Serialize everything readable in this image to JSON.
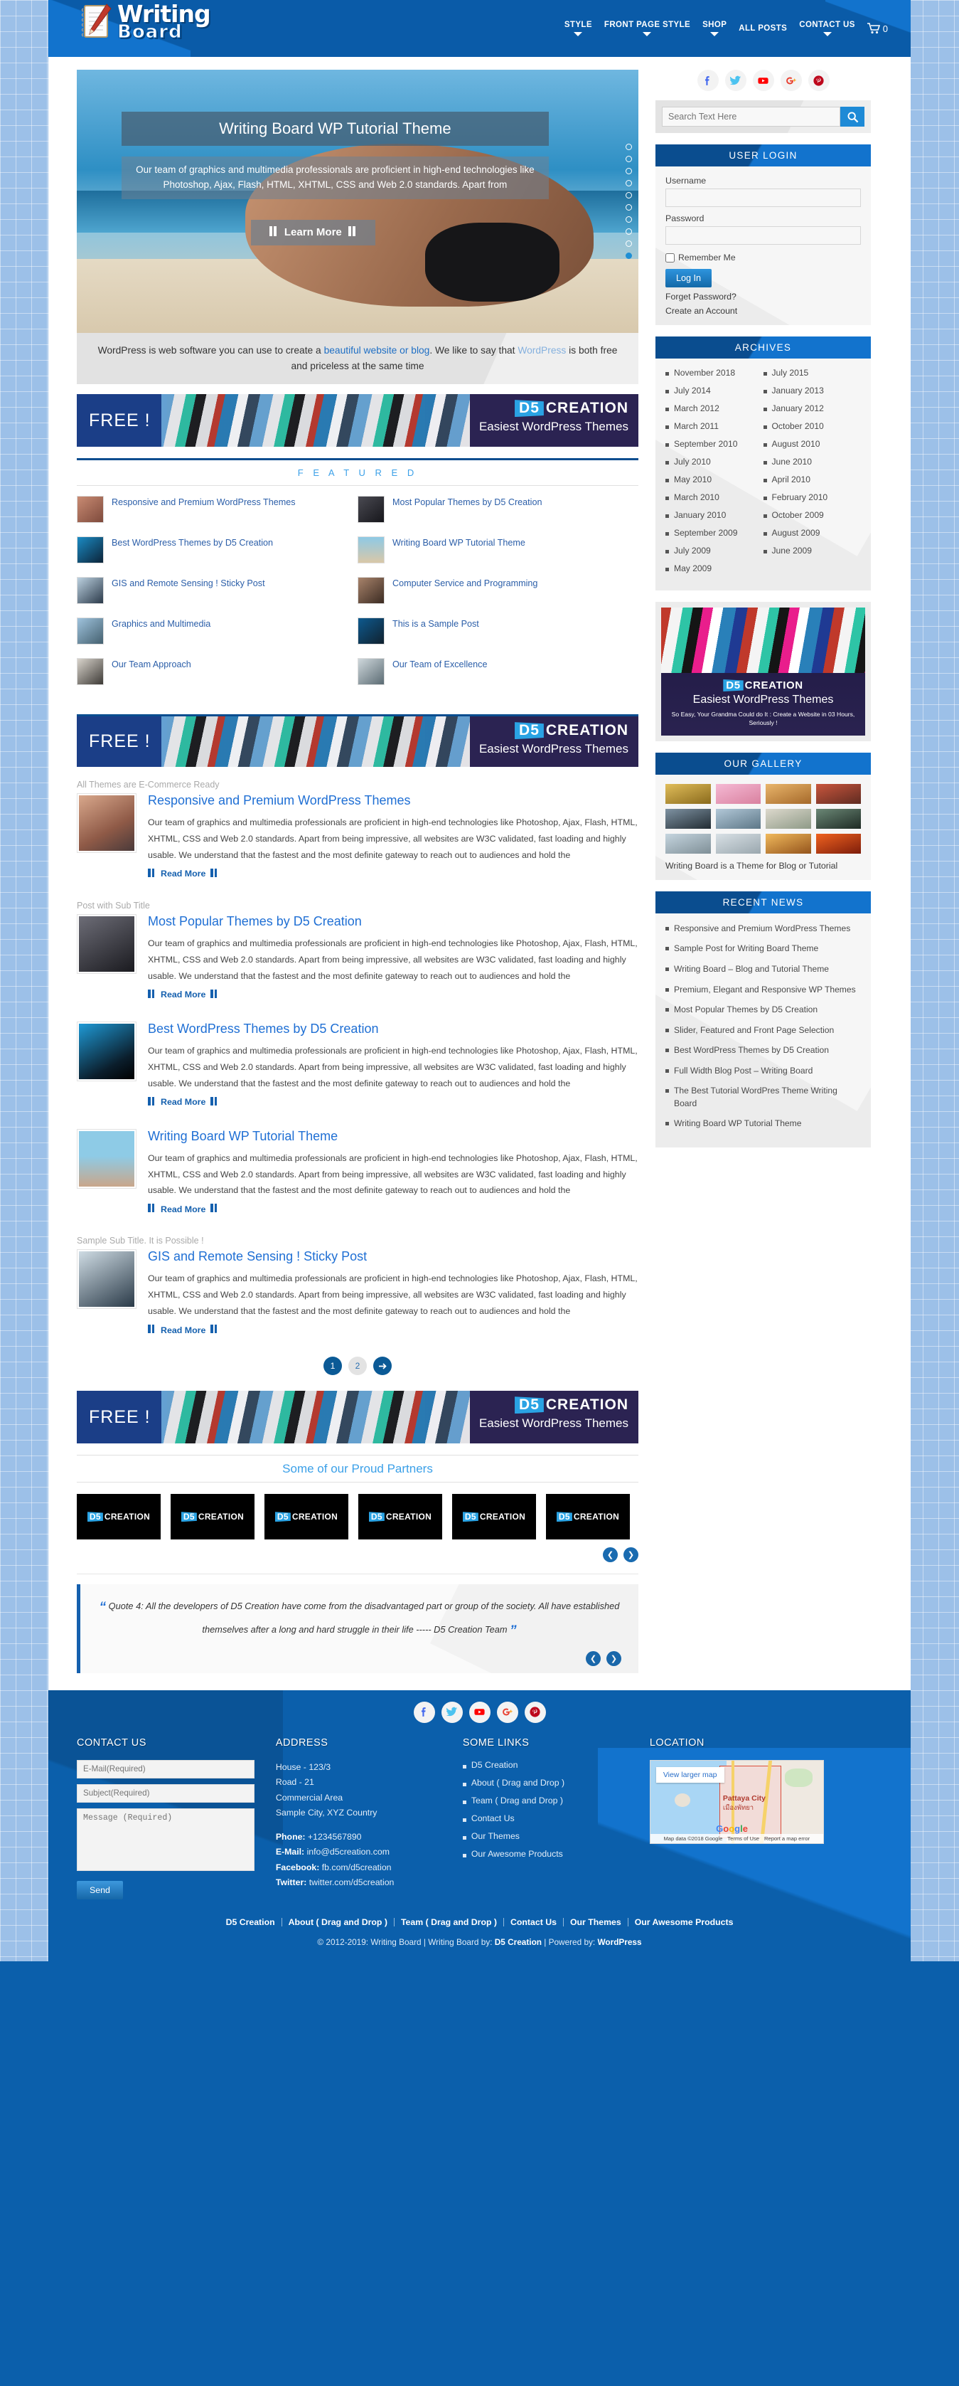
{
  "header": {
    "logo_line1": "Writing",
    "logo_line2": "Board",
    "nav": [
      {
        "label": "STYLE",
        "caret": true
      },
      {
        "label": "FRONT PAGE STYLE",
        "caret": true
      },
      {
        "label": "SHOP",
        "caret": true
      },
      {
        "label": "ALL POSTS",
        "caret": false
      },
      {
        "label": "CONTACT US",
        "caret": true
      }
    ],
    "cart_count": "0"
  },
  "slider": {
    "title": "Writing Board WP Tutorial Theme",
    "description": "Our team of graphics and multimedia professionals are proficient in high-end technologies like Photoshop, Ajax, Flash, HTML, XHTML, CSS and Web 2.0 standards. Apart from",
    "button_label": "Learn More",
    "dots": 10,
    "active_dot": 9
  },
  "intro": {
    "part1": "WordPress is web software you can use to create a ",
    "link1": "beautiful website or blog",
    "part2": ". We like to say that ",
    "link2": "WordPress",
    "part3": " is both free and priceless at the same time"
  },
  "d5_banner": {
    "free": "FREE !",
    "brand_mark": "D5",
    "brand_name": "CREATION",
    "tagline": "Easiest WordPress Themes"
  },
  "featured": {
    "heading": "F E A T U R E D",
    "items": [
      {
        "title": "Responsive and Premium WordPress Themes"
      },
      {
        "title": "Most Popular Themes by D5 Creation"
      },
      {
        "title": "Best WordPress Themes by D5 Creation"
      },
      {
        "title": "Writing Board WP Tutorial Theme"
      },
      {
        "title": "GIS and Remote Sensing ! Sticky Post"
      },
      {
        "title": "Computer Service and Programming"
      },
      {
        "title": "Graphics and Multimedia"
      },
      {
        "title": "This is a Sample Post"
      },
      {
        "title": "Our Team Approach"
      },
      {
        "title": "Our Team of Excellence"
      }
    ]
  },
  "blog": {
    "excerpt": "Our team of graphics and multimedia professionals are proficient in high-end technologies like Photoshop, Ajax, Flash, HTML, XHTML, CSS and Web 2.0 standards. Apart from being impressive, all websites are W3C validated, fast loading and highly usable. We understand that the fastest and the most definite gateway to reach out to audiences and hold the",
    "read_more": "Read More",
    "posts": [
      {
        "subtitle": "All Themes are E-Commerce Ready",
        "title": "Responsive and Premium WordPress Themes"
      },
      {
        "subtitle": "Post with Sub Title",
        "title": "Most Popular Themes by D5 Creation"
      },
      {
        "subtitle": "",
        "title": "Best WordPress Themes by D5 Creation"
      },
      {
        "subtitle": "",
        "title": "Writing Board WP Tutorial Theme"
      },
      {
        "subtitle": "Sample Sub Title. It is Possible !",
        "title": "GIS and Remote Sensing ! Sticky Post"
      }
    ],
    "pagination": {
      "pages": [
        "1",
        "2"
      ],
      "current": "1",
      "next_icon": "arrow-right"
    }
  },
  "partners": {
    "heading": "Some of our Proud Partners",
    "logo_mark": "D5",
    "logo_name": "CREATION",
    "count": 6,
    "prev_icon": "chevron-left",
    "next_icon": "chevron-right"
  },
  "testimonial": {
    "text": "Quote 4: All the developers of D5 Creation have come from the disadvantaged part or group of the society. All have established themselves after a long and hard struggle in their life ----- D5 Creation Team",
    "open_quote": "“",
    "close_quote": "”"
  },
  "sidebar": {
    "social": [
      "facebook-icon",
      "twitter-icon",
      "youtube-icon",
      "google-plus-icon",
      "pinterest-icon"
    ],
    "search": {
      "placeholder": "Search Text Here",
      "button_icon": "search-icon"
    },
    "login": {
      "heading": "USER LOGIN",
      "username_label": "Username",
      "password_label": "Password",
      "remember_label": "Remember Me",
      "submit_label": "Log In",
      "forget_label": "Forget Password?",
      "create_label": "Create an Account"
    },
    "archives": {
      "heading": "ARCHIVES",
      "items": [
        "November 2018",
        "July 2015",
        "July 2014",
        "January 2013",
        "March 2012",
        "January 2012",
        "March 2011",
        "October 2010",
        "September 2010",
        "August 2010",
        "July 2010",
        "June 2010",
        "May 2010",
        "April 2010",
        "March 2010",
        "February 2010",
        "January 2010",
        "October 2009",
        "September 2009",
        "August 2009",
        "July 2009",
        "June 2009",
        "May 2009"
      ]
    },
    "banner": {
      "mark": "D5",
      "name": "CREATION",
      "line2": "Easiest WordPress Themes",
      "line3": "So Easy, Your Grandma Could do It : Create a Website in 03 Hours, Seriously !"
    },
    "gallery": {
      "heading": "OUR GALLERY",
      "caption": "Writing Board is a Theme for Blog or Tutorial",
      "cells": [
        "#c9972f",
        "#f0a8c4",
        "#e1a24a",
        "#b8402c",
        "#4a5f6e",
        "#89a7bd",
        "#c9cfc4",
        "#3c5a4e",
        "#b6c8d4",
        "#cfd9df",
        "#e8a13a",
        "#e0541f"
      ]
    },
    "recent_news": {
      "heading": "RECENT NEWS",
      "items": [
        "Responsive and Premium WordPress Themes",
        "Sample Post for Writing Board Theme",
        "Writing Board – Blog and Tutorial Theme",
        "Premium, Elegant and Responsive WP Themes",
        "Most Popular Themes by D5 Creation",
        "Slider, Featured and Front Page Selection",
        "Best WordPress Themes by D5 Creation",
        "Full Width Blog Post – Writing Board",
        "The Best Tutorial WordPres Theme Writing Board",
        "Writing Board WP Tutorial Theme"
      ]
    }
  },
  "footer": {
    "social": [
      "facebook-icon",
      "twitter-icon",
      "youtube-icon",
      "google-plus-icon",
      "pinterest-icon"
    ],
    "contact": {
      "heading": "CONTACT US",
      "email_placeholder": "E-Mail(Required)",
      "subject_placeholder": "Subject(Required)",
      "message_placeholder": "Message (Required)",
      "send_label": "Send"
    },
    "address": {
      "heading": "ADDRESS",
      "lines": [
        "House - 123/3",
        "Road - 21",
        "Commercial Area",
        "Sample City, XYZ Country"
      ],
      "phone_label": "Phone:",
      "phone_value": " +1234567890",
      "email_label": "E-Mail:",
      "email_value": " info@d5creation.com",
      "facebook_label": "Facebook:",
      "facebook_value": " fb.com/d5creation",
      "twitter_label": "Twitter:",
      "twitter_value": " twitter.com/d5creation"
    },
    "links": {
      "heading": "SOME LINKS",
      "items": [
        "D5 Creation",
        "About ( Drag and Drop )",
        "Team ( Drag and Drop )",
        "Contact Us",
        "Our Themes",
        "Our Awesome Products"
      ]
    },
    "location": {
      "heading": "LOCATION",
      "view_larger": "View larger map",
      "city": "Pattaya City",
      "city_thai": "เมืองพัทยา",
      "google": "Google",
      "attribution": "Map data ©2018 Google",
      "terms": "Terms of Use",
      "report": "Report a map error"
    },
    "bottom_nav": [
      "D5 Creation",
      "About ( Drag and Drop )",
      "Team ( Drag and Drop )",
      "Contact Us",
      "Our Themes",
      "Our Awesome Products"
    ],
    "copyright_pre": "© 2012-2019: Writing Board | Writing Board by: ",
    "copyright_brand": "D5 Creation",
    "copyright_mid": " | Powered by: ",
    "copyright_wp": "WordPress"
  },
  "colors": {
    "brand_blue": "#0b5fab",
    "dark_blue": "#0a4d8f",
    "link_blue": "#1f6fd4",
    "accent_cyan": "#3ba0e8"
  }
}
